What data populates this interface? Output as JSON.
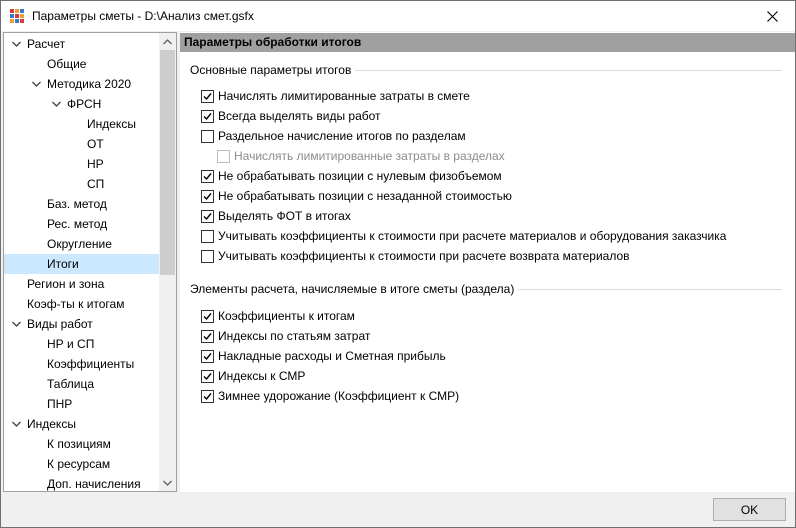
{
  "window": {
    "title": "Параметры сметы - D:\\Анализ смет.gsfx"
  },
  "tree": {
    "items": [
      {
        "label": "Расчет",
        "level": 0,
        "expander": "expanded"
      },
      {
        "label": "Общие",
        "level": 1,
        "expander": "none"
      },
      {
        "label": "Методика 2020",
        "level": 1,
        "expander": "expanded"
      },
      {
        "label": "ФРСН",
        "level": 2,
        "expander": "expanded"
      },
      {
        "label": "Индексы",
        "level": 3,
        "expander": "none"
      },
      {
        "label": "ОТ",
        "level": 3,
        "expander": "none"
      },
      {
        "label": "НР",
        "level": 3,
        "expander": "none"
      },
      {
        "label": "СП",
        "level": 3,
        "expander": "none"
      },
      {
        "label": "Баз. метод",
        "level": 1,
        "expander": "none"
      },
      {
        "label": "Рес. метод",
        "level": 1,
        "expander": "none"
      },
      {
        "label": "Округление",
        "level": 1,
        "expander": "none"
      },
      {
        "label": "Итоги",
        "level": 1,
        "expander": "none",
        "selected": true
      },
      {
        "label": "Регион и зона",
        "level": 0,
        "expander": "none"
      },
      {
        "label": "Коэф-ты к итогам",
        "level": 0,
        "expander": "none"
      },
      {
        "label": "Виды работ",
        "level": 0,
        "expander": "expanded"
      },
      {
        "label": "НР и СП",
        "level": 1,
        "expander": "none"
      },
      {
        "label": "Коэффициенты",
        "level": 1,
        "expander": "none"
      },
      {
        "label": "Таблица",
        "level": 1,
        "expander": "none"
      },
      {
        "label": "ПНР",
        "level": 1,
        "expander": "none"
      },
      {
        "label": "Индексы",
        "level": 0,
        "expander": "expanded"
      },
      {
        "label": "К позициям",
        "level": 1,
        "expander": "none"
      },
      {
        "label": "К ресурсам",
        "level": 1,
        "expander": "none"
      },
      {
        "label": "Доп. начисления",
        "level": 1,
        "expander": "none"
      }
    ]
  },
  "panel": {
    "header": "Параметры обработки итогов",
    "group1": {
      "title": "Основные параметры итогов",
      "options": [
        {
          "label": "Начислять лимитированные затраты в смете",
          "checked": true,
          "indent": 0
        },
        {
          "label": "Всегда выделять виды работ",
          "checked": true,
          "indent": 0
        },
        {
          "label": "Раздельное начисление итогов по разделам",
          "checked": false,
          "indent": 0
        },
        {
          "label": "Начислять лимитированные затраты в разделах",
          "checked": false,
          "indent": 1,
          "disabled": true
        },
        {
          "label": "Не обрабатывать позиции с нулевым физобъемом",
          "checked": true,
          "indent": 0
        },
        {
          "label": "Не обрабатывать позиции с незаданной стоимостью",
          "checked": true,
          "indent": 0
        },
        {
          "label": "Выделять ФОТ в итогах",
          "checked": true,
          "indent": 0
        },
        {
          "label": "Учитывать коэффициенты к стоимости при расчете материалов и оборудования заказчика",
          "checked": false,
          "indent": 0
        },
        {
          "label": "Учитывать коэффициенты к стоимости при расчете возврата материалов",
          "checked": false,
          "indent": 0
        }
      ]
    },
    "group2": {
      "title": "Элементы расчета, начисляемые в итоге сметы (раздела)",
      "options": [
        {
          "label": "Коэффициенты к итогам",
          "checked": true
        },
        {
          "label": "Индексы по статьям затрат",
          "checked": true
        },
        {
          "label": "Накладные расходы и Сметная прибыль",
          "checked": true
        },
        {
          "label": "Индексы к СМР",
          "checked": true
        },
        {
          "label": "Зимнее удорожание (Коэффициент к СМР)",
          "checked": true
        }
      ]
    }
  },
  "footer": {
    "ok_label": "OK"
  },
  "colors": {
    "selection": "#cce8ff",
    "header_bg": "#a0a0a0",
    "window_bg": "#f0f0f0"
  }
}
